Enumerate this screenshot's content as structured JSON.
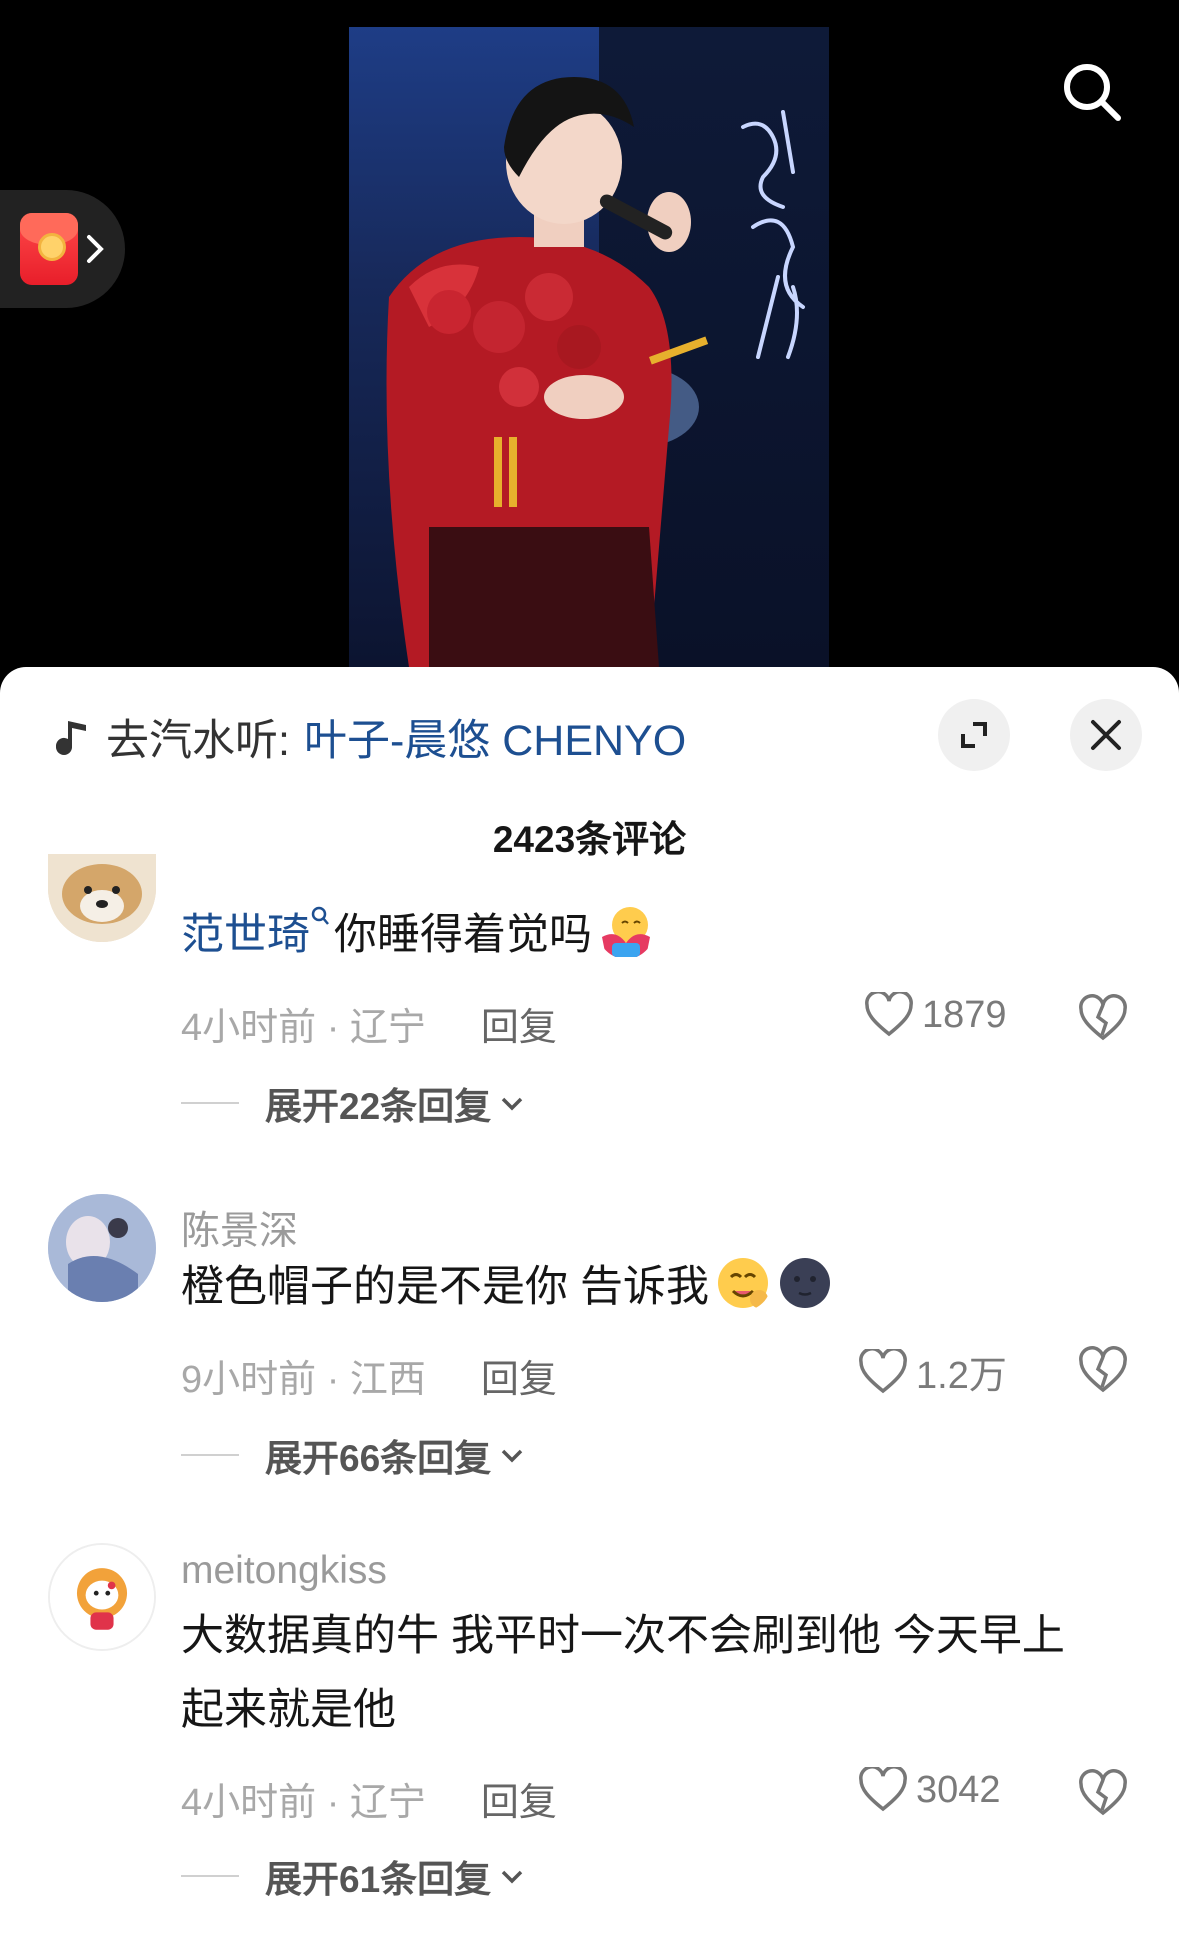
{
  "music": {
    "prefix": "去汽水听:",
    "song": "叶子-晨悠 CHENYO"
  },
  "comment_count": "2423条评论",
  "comments": [
    {
      "user": "范世琦",
      "text": "你睡得着觉吗",
      "time_location": "4小时前 · 辽宁",
      "reply": "回复",
      "likes": "1879",
      "expand": "展开22条回复"
    },
    {
      "user": "陈景深",
      "text": "橙色帽子的是不是你 告诉我",
      "time_location": "9小时前 · 江西",
      "reply": "回复",
      "likes": "1.2万",
      "expand": "展开66条回复"
    },
    {
      "user": "meitongkiss",
      "text_line1": "大数据真的牛 我平时一次不会刷到他 今天早上",
      "text_line2": "起来就是他",
      "time_location": "4小时前 · 辽宁",
      "reply": "回复",
      "likes": "3042",
      "expand": "展开61条回复"
    }
  ],
  "colors": {
    "link_blue": "#1d4f91",
    "background_top": "#000000",
    "sheet": "#ffffff"
  },
  "icons": [
    "search-icon",
    "red-packet-icon",
    "chevron-right-icon",
    "music-note-icon",
    "expand-icon",
    "close-icon",
    "heart-icon",
    "broken-heart-icon",
    "chevron-down-icon",
    "search-tag-icon"
  ]
}
